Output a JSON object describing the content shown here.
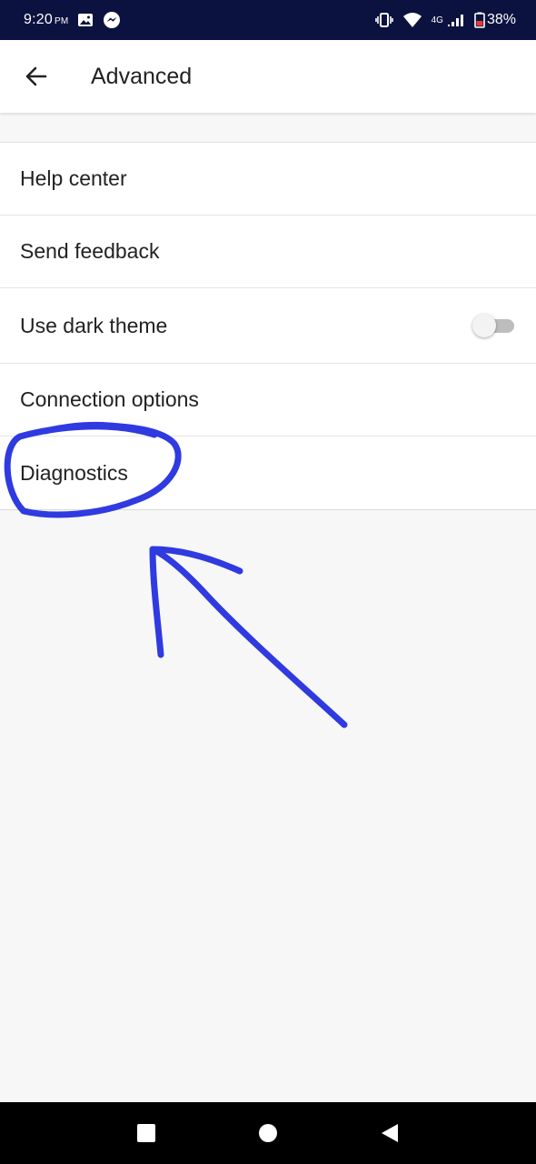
{
  "status_bar": {
    "time": "9:20",
    "meridiem": "PM",
    "network": "4G",
    "battery": "38%",
    "icons": [
      "gallery-icon",
      "messenger-icon",
      "vibrate-icon",
      "wifi-icon",
      "signal-icon",
      "battery-icon"
    ]
  },
  "header": {
    "title": "Advanced",
    "back_icon": "arrow-left-icon"
  },
  "settings": {
    "items": [
      {
        "label": "Help center"
      },
      {
        "label": "Send feedback"
      },
      {
        "label": "Use dark theme",
        "toggle": false
      },
      {
        "label": "Connection options"
      },
      {
        "label": "Diagnostics"
      }
    ]
  },
  "annotation": {
    "color": "#2f3ae0",
    "shapes": [
      "circle around Diagnostics",
      "arrow pointing to Diagnostics"
    ]
  },
  "nav_bar": {
    "icons": [
      "recents-square-icon",
      "home-circle-icon",
      "back-triangle-icon"
    ]
  },
  "colors": {
    "status_bar": "#0c1240",
    "background": "#f7f7f7",
    "toggle_track": "#bdbdbd"
  }
}
